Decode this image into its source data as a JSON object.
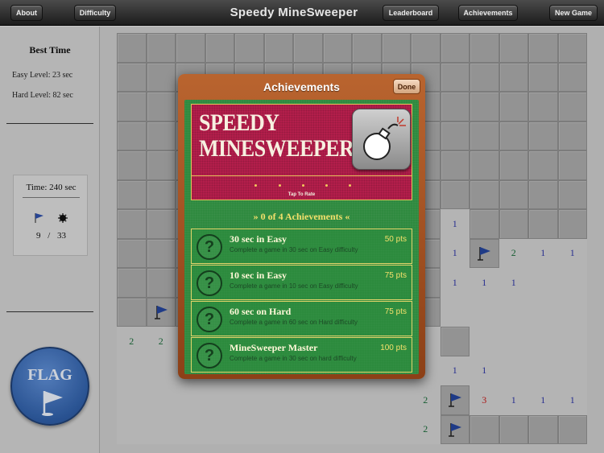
{
  "app": {
    "title": "Speedy MineSweeper"
  },
  "toolbar": {
    "about": "About",
    "difficulty": "Difficulty",
    "leaderboard": "Leaderboard",
    "achievements": "Achievements",
    "new_game": "New Game"
  },
  "sidebar": {
    "best_time_title": "Best Time",
    "easy": "Easy Level: 23 sec",
    "hard": "Hard Level: 82 sec",
    "time": "Time: 240 sec",
    "flags_count": "9",
    "separator": "/",
    "mines_count": "33",
    "flag_button": "FLAG"
  },
  "modal": {
    "title": "Achievements",
    "done": "Done",
    "promo_line1": "SPEEDY",
    "promo_line2": "MINESWEEPER",
    "tap_to_rate": "Tap To Rate",
    "count": "0 of 4 Achievements",
    "items": [
      {
        "name": "30 sec in Easy",
        "desc": "Complete a game in 30 sec on Easy difficulty",
        "points": "50 pts"
      },
      {
        "name": "10 sec in Easy",
        "desc": "Complete a game in 10 sec on Easy difficulty",
        "points": "75 pts"
      },
      {
        "name": "60 sec on Hard",
        "desc": "Complete a game in 60 sec on Hard difficulty",
        "points": "75 pts"
      },
      {
        "name": "MineSweeper Master",
        "desc": "Complete a game in 30 sec on hard difficulty",
        "points": "100 pts"
      }
    ]
  },
  "board": {
    "rows": [
      "hhhhhhhhhhhhhhhh",
      "hhhhhhhhhhhhhhhh",
      "hhhhhhhhhhhhhhhh",
      "hhhhhhhhhhhhhhhh",
      "hhhhhhhhhhhhhhhh",
      "hhhhhhhhhhhhhhhh",
      "hhhhhhhhhhh1hhhh",
      "hhhhhhhhhhh1F211",
      "hhhhhhhhhhh111..",
      "hFhhhhhhhhh.....",
      "22.........h....",
      "...........11...",
      "..........2F3111",
      "..........2Fhhhh"
    ]
  },
  "colors": {
    "topbar": "#2b2b2b",
    "modal_wood": "#a85326",
    "felt": "#2f8a3f",
    "promo": "#b31e4b",
    "accent_yellow": "#f3e06b",
    "flag_blue": "#2f5ea6"
  },
  "icons": [
    "flag-icon",
    "mine-icon",
    "bomb-app-icon",
    "question-icon",
    "arrow-left-icon",
    "arrow-right-icon"
  ]
}
